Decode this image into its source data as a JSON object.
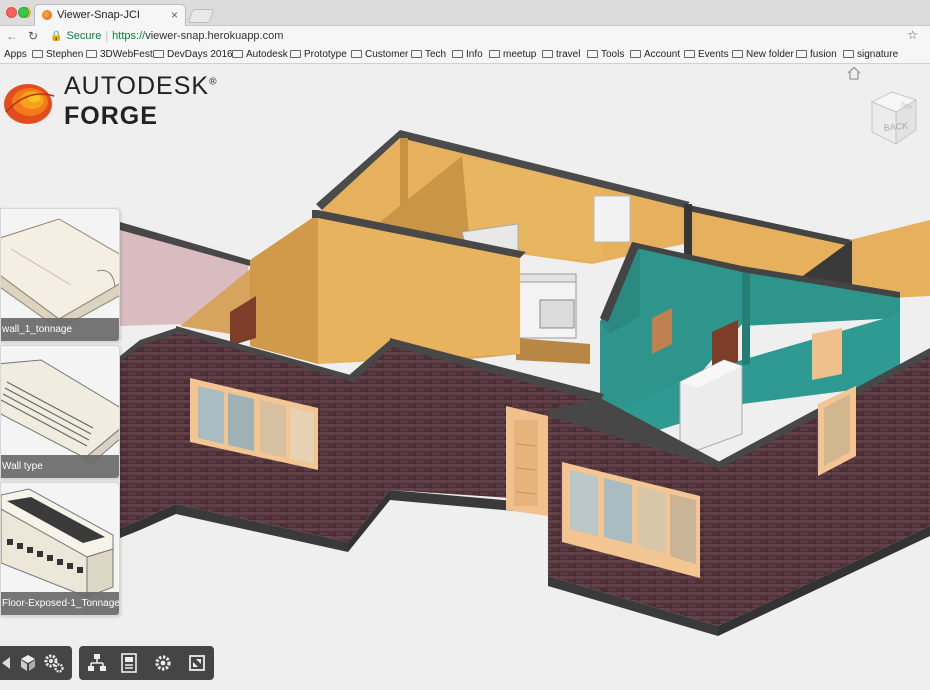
{
  "browser": {
    "tab_title": "Viewer-Snap-JCI",
    "tab_close": "×",
    "secure_label": "Secure",
    "url_proto": "https://",
    "url_rest": "viewer-snap.herokuapp.com",
    "back_icon": "arrow-left-icon",
    "forward_icon": "arrow-right-icon",
    "reload_icon": "reload-icon",
    "star_icon": "star-icon"
  },
  "bookmarks": {
    "apps_label": "Apps",
    "items": [
      "Stephen",
      "3DWebFest",
      "DevDays 2016",
      "Autodesk",
      "Prototype",
      "Customer",
      "Tech",
      "Info",
      "meetup",
      "travel",
      "Tools",
      "Account",
      "Events",
      "New folder",
      "fusion",
      "signature"
    ]
  },
  "logo": {
    "line1": "AUTODESK",
    "reg": "®",
    "line2": "FORGE"
  },
  "viewcube": {
    "label": "BACK",
    "top_label": "TOP"
  },
  "thumbnails": [
    {
      "caption": "wall_1_tonnage"
    },
    {
      "caption": "Wall type"
    },
    {
      "caption": "Floor-Exposed-1_Tonnage"
    }
  ],
  "toolbar": {
    "left": [
      "orbit-icon",
      "model-box-icon",
      "settings-gears-icon"
    ],
    "right": [
      "model-structure-icon",
      "properties-icon",
      "gear-icon",
      "fullscreen-icon"
    ]
  },
  "colors": {
    "brick": "#5a3a42",
    "wall_yellow": "#e8b35e",
    "wall_teal": "#2f9b93",
    "wall_pink": "#d9bcc0",
    "wall_top": "#474747",
    "floor": "#c89a55",
    "window_frame": "#f0c28f"
  }
}
